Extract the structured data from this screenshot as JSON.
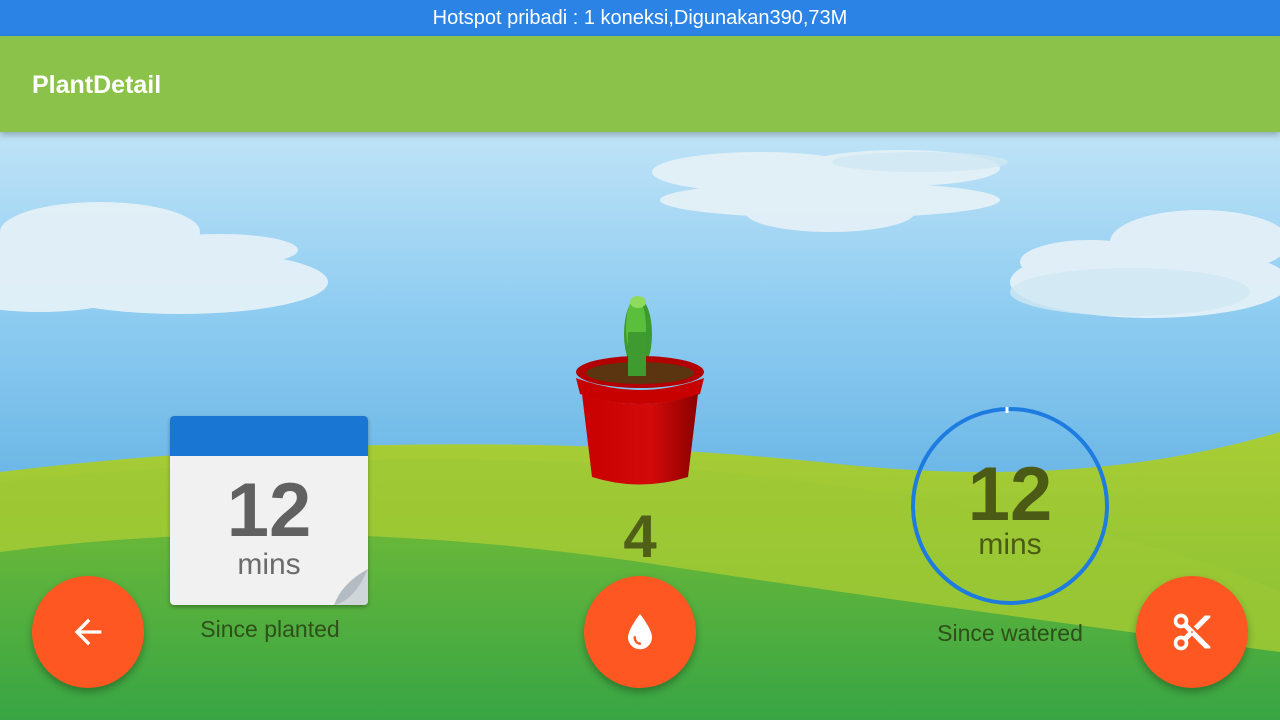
{
  "status_bar": {
    "text": "Hotspot pribadi : 1 koneksi,Digunakan390,73M"
  },
  "app_bar": {
    "title": "PlantDetail"
  },
  "planted": {
    "value": "12",
    "unit": "mins",
    "caption": "Since planted"
  },
  "plant": {
    "water_count": "4"
  },
  "watered": {
    "value": "12",
    "unit": "mins",
    "caption": "Since watered",
    "progress": 0.0
  },
  "buttons": {
    "back_icon": "arrow-left-icon",
    "water_icon": "water-drop-icon",
    "prune_icon": "scissors-icon"
  },
  "colors": {
    "status_bar": "#2b83e6",
    "app_bar": "#8bc34a",
    "fab": "#ff5722",
    "calendar_header": "#1976d2",
    "timer_ring": "#1e7be0"
  }
}
